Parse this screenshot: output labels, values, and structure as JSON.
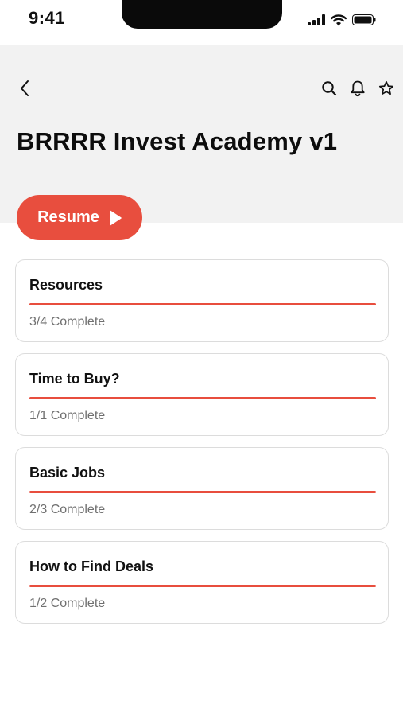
{
  "status_bar": {
    "time": "9:41",
    "icons": [
      "cellular-signal-icon",
      "wifi-icon",
      "battery-icon"
    ]
  },
  "header": {
    "title": "BRRRR Invest Academy v1",
    "icons": {
      "back": "chevron-left-icon",
      "search": "search-icon",
      "notifications": "bell-icon",
      "favorite": "star-icon"
    }
  },
  "resume_button": {
    "label": "Resume",
    "icon": "play-icon"
  },
  "modules": [
    {
      "title": "Resources",
      "status": "3/4 Complete",
      "progress": 1.0
    },
    {
      "title": "Time to Buy?",
      "status": "1/1 Complete",
      "progress": 1.0
    },
    {
      "title": "Basic Jobs",
      "status": "2/3 Complete",
      "progress": 1.0
    },
    {
      "title": "How to Find Deals",
      "status": "1/2 Complete",
      "progress": 1.0
    }
  ],
  "colors": {
    "accent": "#e84e3e",
    "header_bg": "#f2f2f2",
    "card_border": "#dcdcdc",
    "muted_text": "#707070"
  }
}
